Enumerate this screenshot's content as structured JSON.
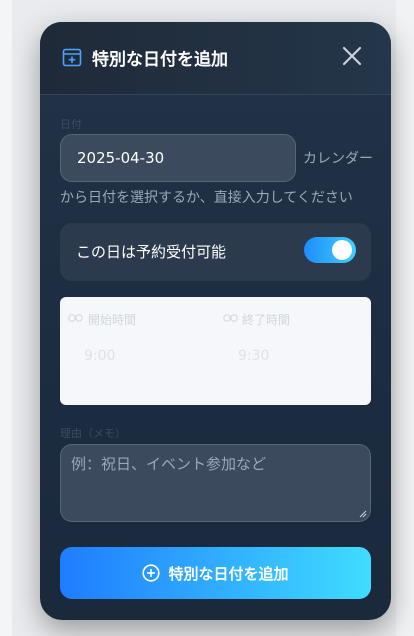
{
  "modal": {
    "title": "特別な日付を追加",
    "date_label": "日付",
    "date_value": "2025-04-30",
    "date_hint_line1": "カレンダー",
    "date_hint_line2": "から日付を選択するか、直接入力してください",
    "toggle_label": "この日は予約受付可能",
    "toggle_on": true,
    "start_time_label": "開始時間",
    "start_time_value": "9:00",
    "end_time_label": "終了時間",
    "end_time_value": "9:30",
    "memo_label": "理由（メモ）",
    "memo_placeholder": "例：祝日、イベント参加など",
    "submit_label": "特別な日付を追加"
  },
  "colors": {
    "accent_start": "#1f7cff",
    "accent_end": "#40dcff",
    "panel": "#1d2d41"
  },
  "icons": {
    "title": "calendar-plus-icon",
    "close": "close-icon",
    "time": "clock-icon",
    "submit": "plus-circle-icon"
  }
}
